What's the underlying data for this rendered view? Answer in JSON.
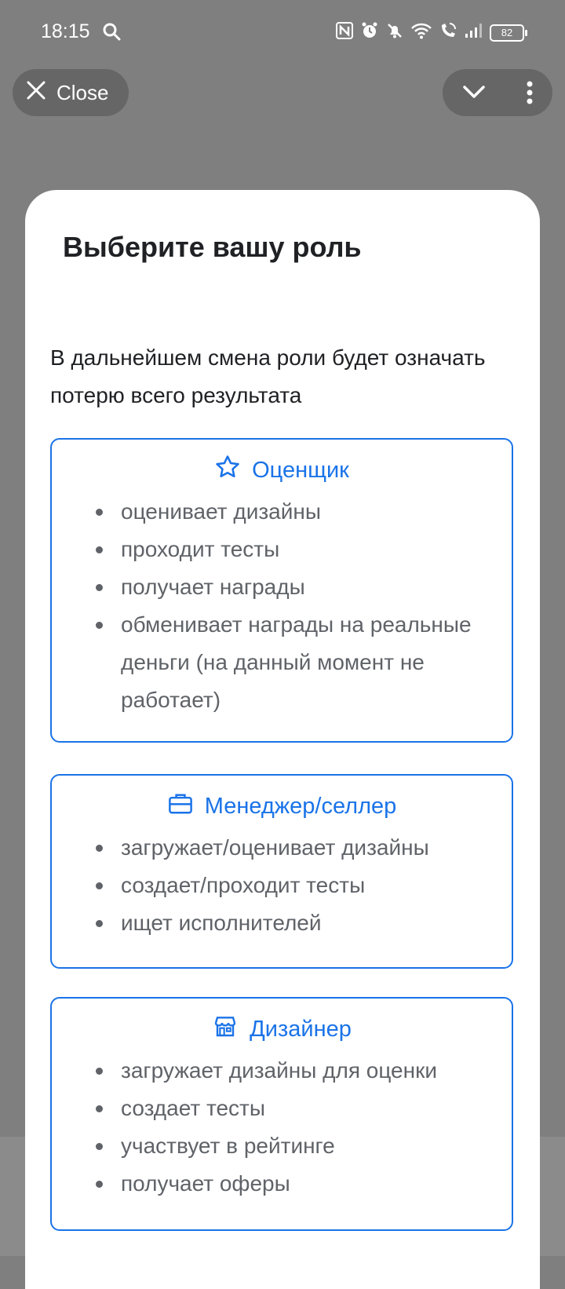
{
  "status_bar": {
    "time": "18:15",
    "battery": "82",
    "icons": [
      "search-icon",
      "nfc-icon",
      "alarm-icon",
      "bell-off-icon",
      "wifi-icon",
      "wifi-call-icon",
      "signal-icon",
      "battery-icon"
    ]
  },
  "top_bar": {
    "close_label": "Close",
    "icons": [
      "close-icon",
      "chevron-down-icon",
      "more-vert-icon"
    ]
  },
  "dialog": {
    "title": "Выберите вашу роль",
    "subtitle": "В дальнейшем смена роли будет означать потерю всего результата",
    "accent_color": "#1a73e8",
    "roles": [
      {
        "icon": "star-icon",
        "name": "Оценщик",
        "features": [
          "оценивает дизайны",
          "проходит тесты",
          "получает награды",
          "обменивает награды на реальные деньги (на данный момент не работает)"
        ]
      },
      {
        "icon": "briefcase-icon",
        "name": "Менеджер/селлер",
        "features": [
          "загружает/оценивает дизайны",
          "создает/проходит тесты",
          "ищет исполнителей"
        ]
      },
      {
        "icon": "store-icon",
        "name": "Дизайнер",
        "features": [
          "загружает дизайны для оценки",
          "создает тесты",
          "участвует в рейтинге",
          "получает оферы"
        ]
      }
    ]
  }
}
